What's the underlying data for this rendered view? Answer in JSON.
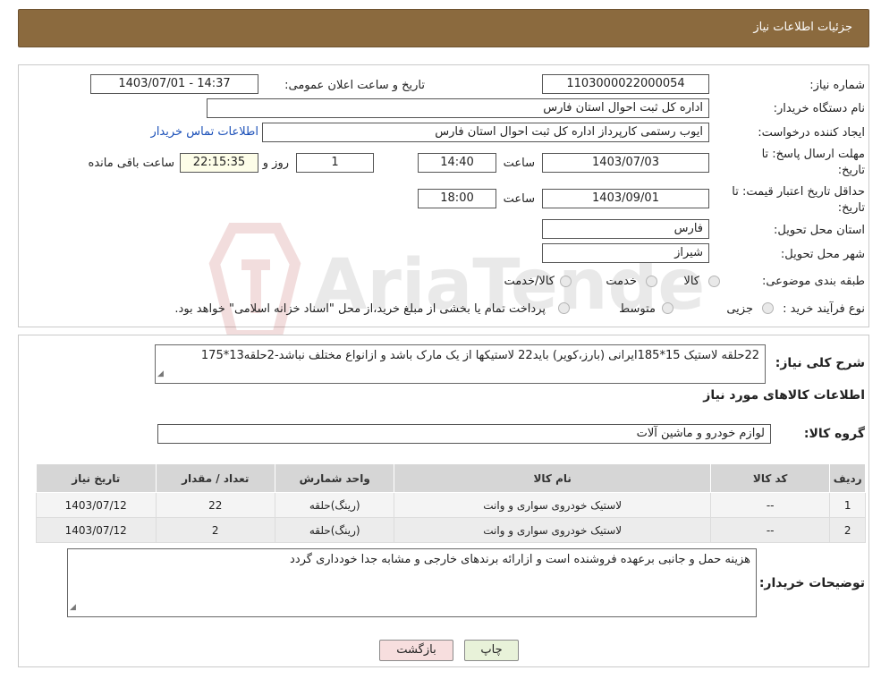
{
  "header": {
    "title": "جزئیات اطلاعات نیاز"
  },
  "need": {
    "number_label": "شماره نیاز:",
    "number": "1103000022000054",
    "announce_label": "تاریخ و ساعت اعلان عمومی:",
    "announce_value": "1403/07/01 - 14:37",
    "buyer_label": "نام دستگاه خریدار:",
    "buyer": "اداره کل ثبت احوال استان فارس",
    "creator_label": "ایجاد کننده درخواست:",
    "creator": "ایوب رستمی کارپرداز اداره کل ثبت احوال استان فارس",
    "contact_link": "اطلاعات تماس خریدار",
    "deadline_label_1": "مهلت ارسال پاسخ: تا",
    "deadline_label_2": "تاریخ:",
    "deadline_date": "1403/07/03",
    "time_label": "ساعت",
    "deadline_time": "14:40",
    "days_value": "1",
    "days_label": "روز و",
    "remaining_value": "22:15:35",
    "remaining_label": "ساعت باقی مانده",
    "validity_label_1": "حداقل تاریخ اعتبار قیمت: تا",
    "validity_label_2": "تاریخ:",
    "validity_date": "1403/09/01",
    "validity_time": "18:00",
    "province_label": "استان محل تحویل:",
    "province": "فارس",
    "city_label": "شهر محل تحویل:",
    "city": "شیراز",
    "category_label": "طبقه بندی موضوعی:",
    "category_options": [
      "کالا",
      "خدمت",
      "کالا/خدمت"
    ],
    "process_label": "نوع فرآیند خرید :",
    "process_options": [
      "جزیی",
      "متوسط"
    ],
    "payment_note": "پرداخت تمام یا بخشی از مبلغ خرید،از محل \"اسناد خزانه اسلامی\" خواهد بود."
  },
  "details": {
    "summary_label": "شرح کلی نیاز:",
    "summary": "22حلقه لاستیک 15*185ایرانی (بارز،کویر) باید22 لاستیکها از یک مارک باشد و ازانواع مختلف نباشد-2حلقه13*175",
    "goods_info_title": "اطلاعات کالاهای مورد نیاز",
    "group_label": "گروه کالا:",
    "group": "لوازم خودرو و ماشین آلات",
    "table_headers": [
      "ردیف",
      "کد کالا",
      "نام کالا",
      "واحد شمارش",
      "تعداد / مقدار",
      "تاریخ نیاز"
    ],
    "table_rows": [
      [
        "1",
        "--",
        "لاستیک خودروی سواری و وانت",
        "(رینگ)حلقه",
        "22",
        "1403/07/12"
      ],
      [
        "2",
        "--",
        "لاستیک خودروی سواری و وانت",
        "(رینگ)حلقه",
        "2",
        "1403/07/12"
      ]
    ],
    "buyer_notes_label": "توضیحات خریدار:",
    "buyer_notes": "هزینه حمل و جانبی برعهده فروشنده است و ازارائه برندهای خارجی و مشابه جدا خودداری گردد"
  },
  "buttons": {
    "print": "چاپ",
    "back": "بازگشت"
  },
  "watermark": {
    "text": "AriaTender.neT"
  }
}
